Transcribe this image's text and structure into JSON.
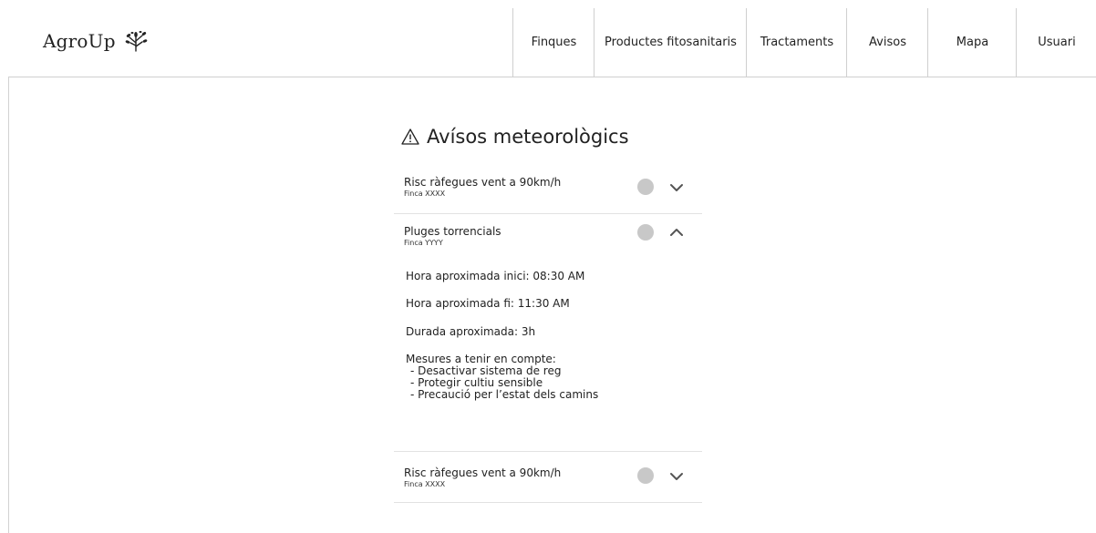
{
  "app": {
    "logo_text": "AgroUp"
  },
  "nav": {
    "items": [
      {
        "label": "Finques"
      },
      {
        "label": "Productes fitosanitaris"
      },
      {
        "label": "Tractaments"
      },
      {
        "label": "Avisos"
      },
      {
        "label": "Mapa"
      },
      {
        "label": "Usuari"
      }
    ]
  },
  "main": {
    "title": "Avísos meteorològics",
    "alerts": [
      {
        "title": "Risc ràfegues vent a 90km/h",
        "farm": "Finca XXXX",
        "expanded": false
      },
      {
        "title": "Pluges torrencials",
        "farm": "Finca YYYY",
        "expanded": true,
        "details": {
          "start": "Hora aproximada inici: 08:30 AM",
          "end": "Hora aproximada fi: 11:30 AM",
          "duration": "Durada aproximada: 3h",
          "measures_heading": "Mesures a tenir en compte:",
          "measures": [
            "- Desactivar sistema de reg",
            "- Protegir cultiu sensible",
            "- Precaució per l’estat dels camins"
          ]
        }
      },
      {
        "title": "Risc ràfegues vent a 90km/h",
        "farm": "Finca XXXX",
        "expanded": false
      }
    ]
  },
  "colors": {
    "status_dot": "#c8c8c8",
    "border": "#cfcfcf",
    "text": "#222222"
  }
}
